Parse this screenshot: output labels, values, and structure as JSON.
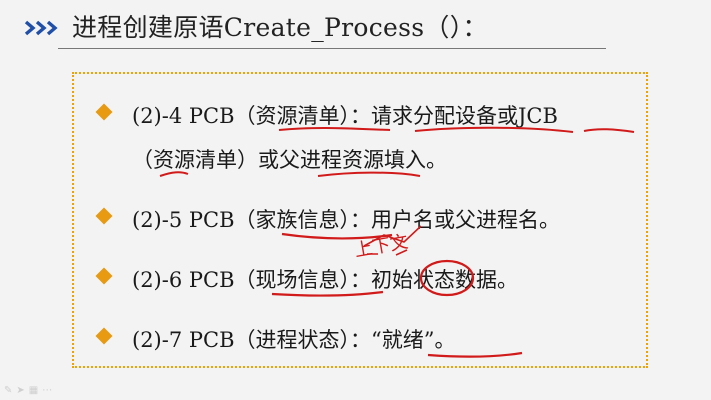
{
  "slide": {
    "title": "进程创建原语Create_Process（）：",
    "items": [
      {
        "line1": "(2)-4   PCB（资源清单）：请求分配设备或JCB",
        "line2": "（资源清单）或父进程资源填入。"
      },
      {
        "line1": "(2)-5    PCB（家族信息）：用户名或父进程名。"
      },
      {
        "line1": "(2)-6    PCB（现场信息）：初始状态数据。",
        "handwritten_note": "上下文"
      },
      {
        "line1": "(2)-7    PCB（进程状态）：“就绪”。"
      }
    ],
    "colors": {
      "bullet": "#e79a12",
      "box_border": "#f2a200",
      "title_chevrons": "#1f4fa8",
      "annotation_ink": "#d11a1a"
    }
  }
}
